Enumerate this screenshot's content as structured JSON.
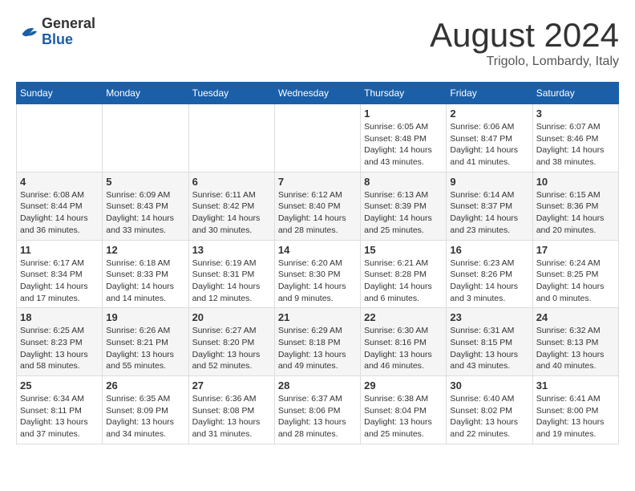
{
  "header": {
    "logo_general": "General",
    "logo_blue": "Blue",
    "month_title": "August 2024",
    "location": "Trigolo, Lombardy, Italy"
  },
  "weekdays": [
    "Sunday",
    "Monday",
    "Tuesday",
    "Wednesday",
    "Thursday",
    "Friday",
    "Saturday"
  ],
  "weeks": [
    [
      {
        "day": "",
        "info": ""
      },
      {
        "day": "",
        "info": ""
      },
      {
        "day": "",
        "info": ""
      },
      {
        "day": "",
        "info": ""
      },
      {
        "day": "1",
        "info": "Sunrise: 6:05 AM\nSunset: 8:48 PM\nDaylight: 14 hours\nand 43 minutes."
      },
      {
        "day": "2",
        "info": "Sunrise: 6:06 AM\nSunset: 8:47 PM\nDaylight: 14 hours\nand 41 minutes."
      },
      {
        "day": "3",
        "info": "Sunrise: 6:07 AM\nSunset: 8:46 PM\nDaylight: 14 hours\nand 38 minutes."
      }
    ],
    [
      {
        "day": "4",
        "info": "Sunrise: 6:08 AM\nSunset: 8:44 PM\nDaylight: 14 hours\nand 36 minutes."
      },
      {
        "day": "5",
        "info": "Sunrise: 6:09 AM\nSunset: 8:43 PM\nDaylight: 14 hours\nand 33 minutes."
      },
      {
        "day": "6",
        "info": "Sunrise: 6:11 AM\nSunset: 8:42 PM\nDaylight: 14 hours\nand 30 minutes."
      },
      {
        "day": "7",
        "info": "Sunrise: 6:12 AM\nSunset: 8:40 PM\nDaylight: 14 hours\nand 28 minutes."
      },
      {
        "day": "8",
        "info": "Sunrise: 6:13 AM\nSunset: 8:39 PM\nDaylight: 14 hours\nand 25 minutes."
      },
      {
        "day": "9",
        "info": "Sunrise: 6:14 AM\nSunset: 8:37 PM\nDaylight: 14 hours\nand 23 minutes."
      },
      {
        "day": "10",
        "info": "Sunrise: 6:15 AM\nSunset: 8:36 PM\nDaylight: 14 hours\nand 20 minutes."
      }
    ],
    [
      {
        "day": "11",
        "info": "Sunrise: 6:17 AM\nSunset: 8:34 PM\nDaylight: 14 hours\nand 17 minutes."
      },
      {
        "day": "12",
        "info": "Sunrise: 6:18 AM\nSunset: 8:33 PM\nDaylight: 14 hours\nand 14 minutes."
      },
      {
        "day": "13",
        "info": "Sunrise: 6:19 AM\nSunset: 8:31 PM\nDaylight: 14 hours\nand 12 minutes."
      },
      {
        "day": "14",
        "info": "Sunrise: 6:20 AM\nSunset: 8:30 PM\nDaylight: 14 hours\nand 9 minutes."
      },
      {
        "day": "15",
        "info": "Sunrise: 6:21 AM\nSunset: 8:28 PM\nDaylight: 14 hours\nand 6 minutes."
      },
      {
        "day": "16",
        "info": "Sunrise: 6:23 AM\nSunset: 8:26 PM\nDaylight: 14 hours\nand 3 minutes."
      },
      {
        "day": "17",
        "info": "Sunrise: 6:24 AM\nSunset: 8:25 PM\nDaylight: 14 hours\nand 0 minutes."
      }
    ],
    [
      {
        "day": "18",
        "info": "Sunrise: 6:25 AM\nSunset: 8:23 PM\nDaylight: 13 hours\nand 58 minutes."
      },
      {
        "day": "19",
        "info": "Sunrise: 6:26 AM\nSunset: 8:21 PM\nDaylight: 13 hours\nand 55 minutes."
      },
      {
        "day": "20",
        "info": "Sunrise: 6:27 AM\nSunset: 8:20 PM\nDaylight: 13 hours\nand 52 minutes."
      },
      {
        "day": "21",
        "info": "Sunrise: 6:29 AM\nSunset: 8:18 PM\nDaylight: 13 hours\nand 49 minutes."
      },
      {
        "day": "22",
        "info": "Sunrise: 6:30 AM\nSunset: 8:16 PM\nDaylight: 13 hours\nand 46 minutes."
      },
      {
        "day": "23",
        "info": "Sunrise: 6:31 AM\nSunset: 8:15 PM\nDaylight: 13 hours\nand 43 minutes."
      },
      {
        "day": "24",
        "info": "Sunrise: 6:32 AM\nSunset: 8:13 PM\nDaylight: 13 hours\nand 40 minutes."
      }
    ],
    [
      {
        "day": "25",
        "info": "Sunrise: 6:34 AM\nSunset: 8:11 PM\nDaylight: 13 hours\nand 37 minutes."
      },
      {
        "day": "26",
        "info": "Sunrise: 6:35 AM\nSunset: 8:09 PM\nDaylight: 13 hours\nand 34 minutes."
      },
      {
        "day": "27",
        "info": "Sunrise: 6:36 AM\nSunset: 8:08 PM\nDaylight: 13 hours\nand 31 minutes."
      },
      {
        "day": "28",
        "info": "Sunrise: 6:37 AM\nSunset: 8:06 PM\nDaylight: 13 hours\nand 28 minutes."
      },
      {
        "day": "29",
        "info": "Sunrise: 6:38 AM\nSunset: 8:04 PM\nDaylight: 13 hours\nand 25 minutes."
      },
      {
        "day": "30",
        "info": "Sunrise: 6:40 AM\nSunset: 8:02 PM\nDaylight: 13 hours\nand 22 minutes."
      },
      {
        "day": "31",
        "info": "Sunrise: 6:41 AM\nSunset: 8:00 PM\nDaylight: 13 hours\nand 19 minutes."
      }
    ]
  ]
}
